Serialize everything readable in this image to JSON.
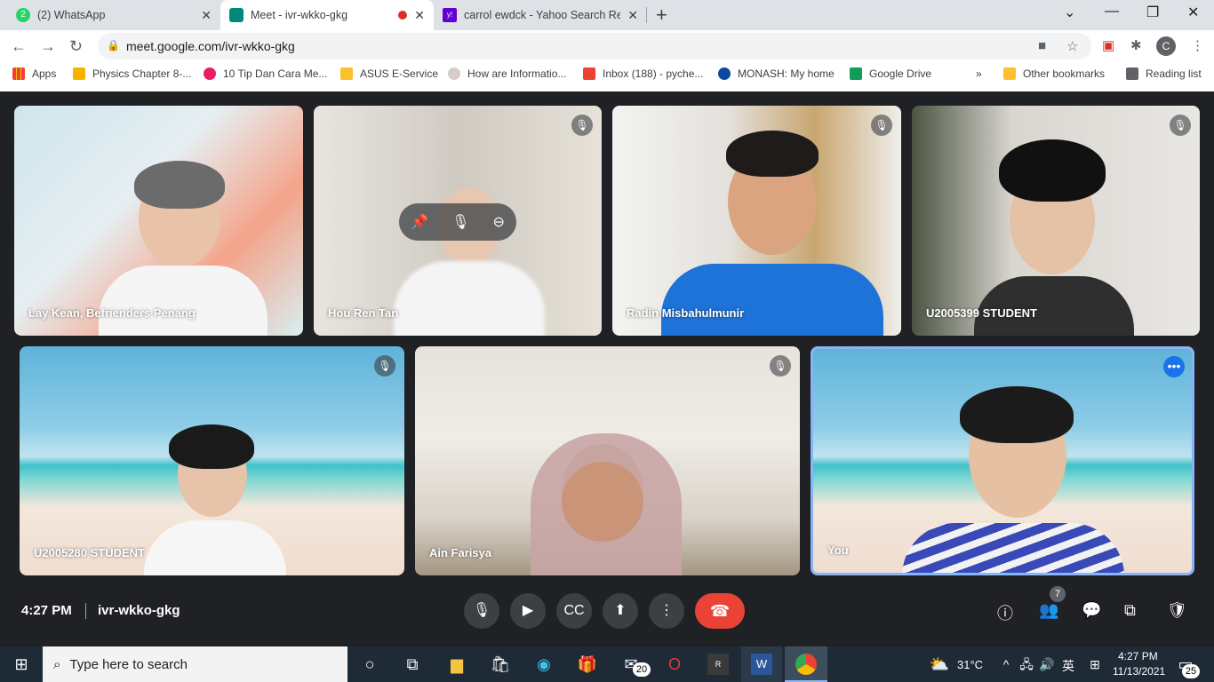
{
  "tabs": [
    {
      "title": "(2) WhatsApp",
      "favicon_color": "#25d366",
      "favicon_text": "2"
    },
    {
      "title": "Meet - ivr-wkko-gkg",
      "favicon_color": "#00897b"
    },
    {
      "title": "carrol ewdck - Yahoo Search Resu",
      "favicon_color": "#6001d2",
      "favicon_text": "y!"
    }
  ],
  "url": "meet.google.com/ivr-wkko-gkg",
  "profile_initial": "C",
  "bookmarks": [
    {
      "label": "Apps",
      "color": "#ea4335"
    },
    {
      "label": "Physics Chapter 8-...",
      "color": "#f4b400"
    },
    {
      "label": "10 Tip Dan Cara Me...",
      "color": "#e91e63"
    },
    {
      "label": "ASUS E-Service",
      "color": "#fbc02d"
    },
    {
      "label": "How are Informatio...",
      "color": "#d7ccc8"
    },
    {
      "label": "Inbox (188) - pyche...",
      "color": "#ea4335"
    },
    {
      "label": "MONASH: My home",
      "color": "#0d47a1"
    },
    {
      "label": "Google Drive",
      "color": "#0f9d58"
    },
    {
      "label": "Other bookmarks",
      "color": "#fbc02d"
    },
    {
      "label": "Reading list",
      "color": "#5f6368"
    }
  ],
  "bookmarks_more": "»",
  "participants": [
    {
      "name": "Lay Kean, Befrienders Penang"
    },
    {
      "name": "Hou Ren Tan"
    },
    {
      "name": "Radin Misbahulmunir"
    },
    {
      "name": "U2005399 STUDENT"
    },
    {
      "name": "U2005280 STUDENT"
    },
    {
      "name": "Ain Farisya"
    },
    {
      "name": "You"
    }
  ],
  "meeting": {
    "time": "4:27 PM",
    "code": "ivr-wkko-gkg",
    "people_count": "7"
  },
  "taskbar": {
    "search_placeholder": "Type here to search",
    "weather": "31°C",
    "ime": "英",
    "clock_time": "4:27 PM",
    "clock_date": "11/13/2021",
    "mail_count": "20",
    "notif_count": "25"
  }
}
